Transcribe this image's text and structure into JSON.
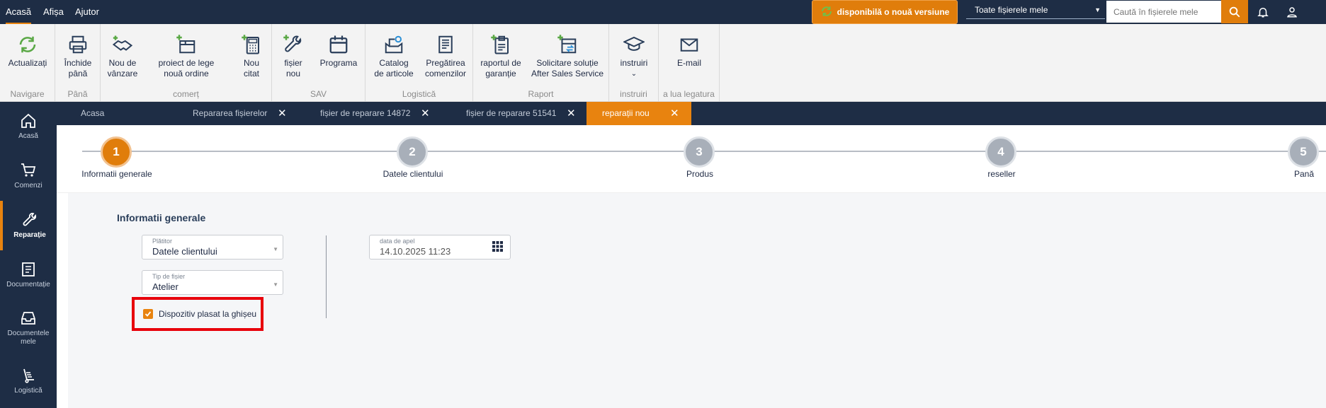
{
  "menu": [
    {
      "label": "Acasă",
      "active": true
    },
    {
      "label": "Afișa",
      "active": false
    },
    {
      "label": "Ajutor",
      "active": false
    }
  ],
  "update_banner": "disponibilă o nouă versiune",
  "scope_select": "Toate fișierele mele",
  "search": {
    "placeholder": "Caută în fișierele mele",
    "value": ""
  },
  "ribbon": {
    "navigare": {
      "label": "Navigare",
      "buttons": [
        {
          "label": "Actualizați",
          "icon": "refresh-icon"
        }
      ]
    },
    "pana": {
      "label": "Până",
      "buttons": [
        {
          "label": "Închide până",
          "icon": "printer-icon"
        }
      ]
    },
    "comert": {
      "label": "comerț",
      "buttons": [
        {
          "label": "Nou de vânzare",
          "icon": "handshake-icon"
        },
        {
          "label": "proiect de lege nouă ordine",
          "icon": "box-plus-icon"
        },
        {
          "label": "Nou citat",
          "icon": "calculator-plus-icon"
        }
      ]
    },
    "sav": {
      "label": "SAV",
      "buttons": [
        {
          "label": "fișier nou",
          "icon": "wrench-plus-icon"
        },
        {
          "label": "Programa",
          "icon": "calendar-icon"
        }
      ]
    },
    "logistica": {
      "label": "Logistică",
      "buttons": [
        {
          "label": "Catalog de articole",
          "icon": "catalog-gear-icon"
        },
        {
          "label": "Pregătirea comenzilor",
          "icon": "checklist-icon"
        }
      ]
    },
    "raport": {
      "label": "Raport",
      "buttons": [
        {
          "label": "raportul de garanție",
          "icon": "clipboard-plus-icon"
        },
        {
          "label": "Solicitare soluție After Sales Service",
          "icon": "transfer-plus-icon"
        }
      ]
    },
    "instruiri": {
      "label": "instruiri",
      "buttons": [
        {
          "label": "instruiri",
          "icon": "graduation-cap-icon"
        }
      ]
    },
    "legatura": {
      "label": "a lua legatura",
      "buttons": [
        {
          "label": "E-mail",
          "icon": "envelope-icon"
        }
      ]
    }
  },
  "sidebar": [
    {
      "label": "Acasă",
      "icon": "home-icon",
      "active": false
    },
    {
      "label": "Comenzi",
      "icon": "cart-icon",
      "active": false
    },
    {
      "label": "Reparație",
      "icon": "wrench-icon",
      "active": true
    },
    {
      "label": "Documentație",
      "icon": "document-icon",
      "active": false
    },
    {
      "label": "Documentele mele",
      "icon": "inbox-icon",
      "active": false
    },
    {
      "label": "Logistică",
      "icon": "hand-truck-icon",
      "active": false
    }
  ],
  "tabs": [
    {
      "label": "Acasa",
      "closable": false,
      "active": false
    },
    {
      "label": "Repararea fișierelor",
      "closable": true,
      "active": false
    },
    {
      "label": "fișier de reparare 14872",
      "closable": true,
      "active": false
    },
    {
      "label": "fișier de reparare 51541",
      "closable": true,
      "active": false
    },
    {
      "label": "reparații nou",
      "closable": true,
      "active": true
    }
  ],
  "steps": [
    {
      "number": "1",
      "label": "Informatii generale",
      "active": true
    },
    {
      "number": "2",
      "label": "Datele clientului",
      "active": false
    },
    {
      "number": "3",
      "label": "Produs",
      "active": false
    },
    {
      "number": "4",
      "label": "reseller",
      "active": false
    },
    {
      "number": "5",
      "label": "Pană",
      "active": false
    }
  ],
  "form": {
    "title": "Informatii generale",
    "platitor": {
      "label": "Plătitor",
      "value": "Datele clientului"
    },
    "tip_fisier": {
      "label": "Tip de fișier",
      "value": "Atelier"
    },
    "data_apel": {
      "label": "data de apel",
      "value": "14.10.2025 11:23"
    },
    "checkbox": {
      "label": "Dispozitiv plasat la ghișeu",
      "checked": true
    }
  },
  "colors": {
    "accent": "#e8830f",
    "navy": "#1e2d45",
    "highlight": "#e8000b"
  }
}
